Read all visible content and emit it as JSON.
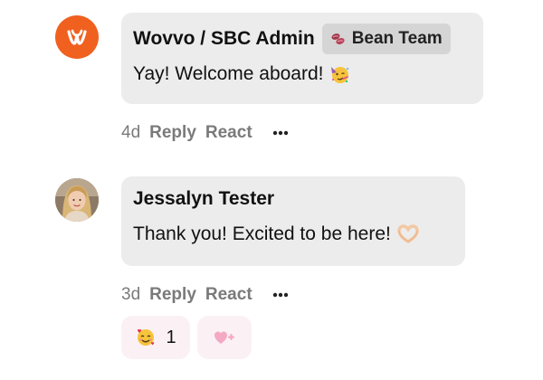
{
  "comments": [
    {
      "author": "Wovvo / SBC Admin",
      "badge": "Bean Team",
      "badge_icon": "bean-icon",
      "message": "Yay! Welcome aboard!",
      "message_emoji": "partying-face-icon",
      "time": "4d",
      "reply_label": "Reply",
      "react_label": "React",
      "avatar": "wovvo-logo-icon",
      "accent": "#f0601f"
    },
    {
      "author": "Jessalyn Tester",
      "message": "Thank you! Excited to be here!",
      "message_emoji": "heart-hands-icon",
      "time": "3d",
      "reply_label": "Reply",
      "react_label": "React",
      "avatar": "profile-photo",
      "reactions": [
        {
          "emoji": "smiling-face-with-hearts-icon",
          "count": "1"
        }
      ],
      "add_reaction_icon": "add-heart-icon"
    }
  ],
  "colors": {
    "bubble": "#ececec",
    "badge": "#d5d5d5",
    "meta_text": "#7a7a7a",
    "reaction_pill": "#fbf1f4"
  }
}
